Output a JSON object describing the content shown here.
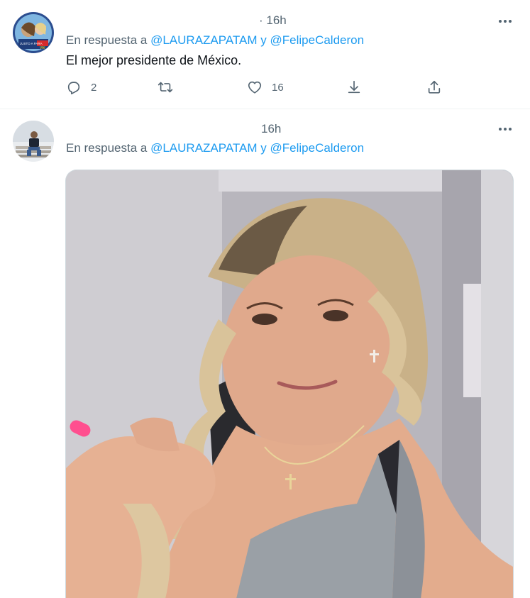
{
  "tweets": [
    {
      "time": "· 16h",
      "reply_prefix": "En respuesta a",
      "mention_1": "@LAURAZAPATAM",
      "conjunction": "y",
      "mention_2": "@FelipeCalderon",
      "text": "El mejor presidente de México.",
      "avatar_text": "JUSTO A PARA VAI",
      "actions": {
        "reply_count": "2",
        "retweet_count": "",
        "like_count": "16"
      }
    },
    {
      "time": "16h",
      "reply_prefix": "En respuesta a",
      "mention_1": "@LAURAZAPATAM",
      "conjunction": "y",
      "mention_2": "@FelipeCalderon",
      "media": "photo"
    }
  ],
  "icons": {
    "more": "more-dots-icon",
    "reply": "reply-icon",
    "retweet": "retweet-icon",
    "like": "heart-icon",
    "download": "download-icon",
    "share": "share-icon"
  },
  "colors": {
    "link": "#1d9bf0",
    "secondary_text": "#536471",
    "primary_text": "#0f1419",
    "divider": "#eff3f4"
  }
}
